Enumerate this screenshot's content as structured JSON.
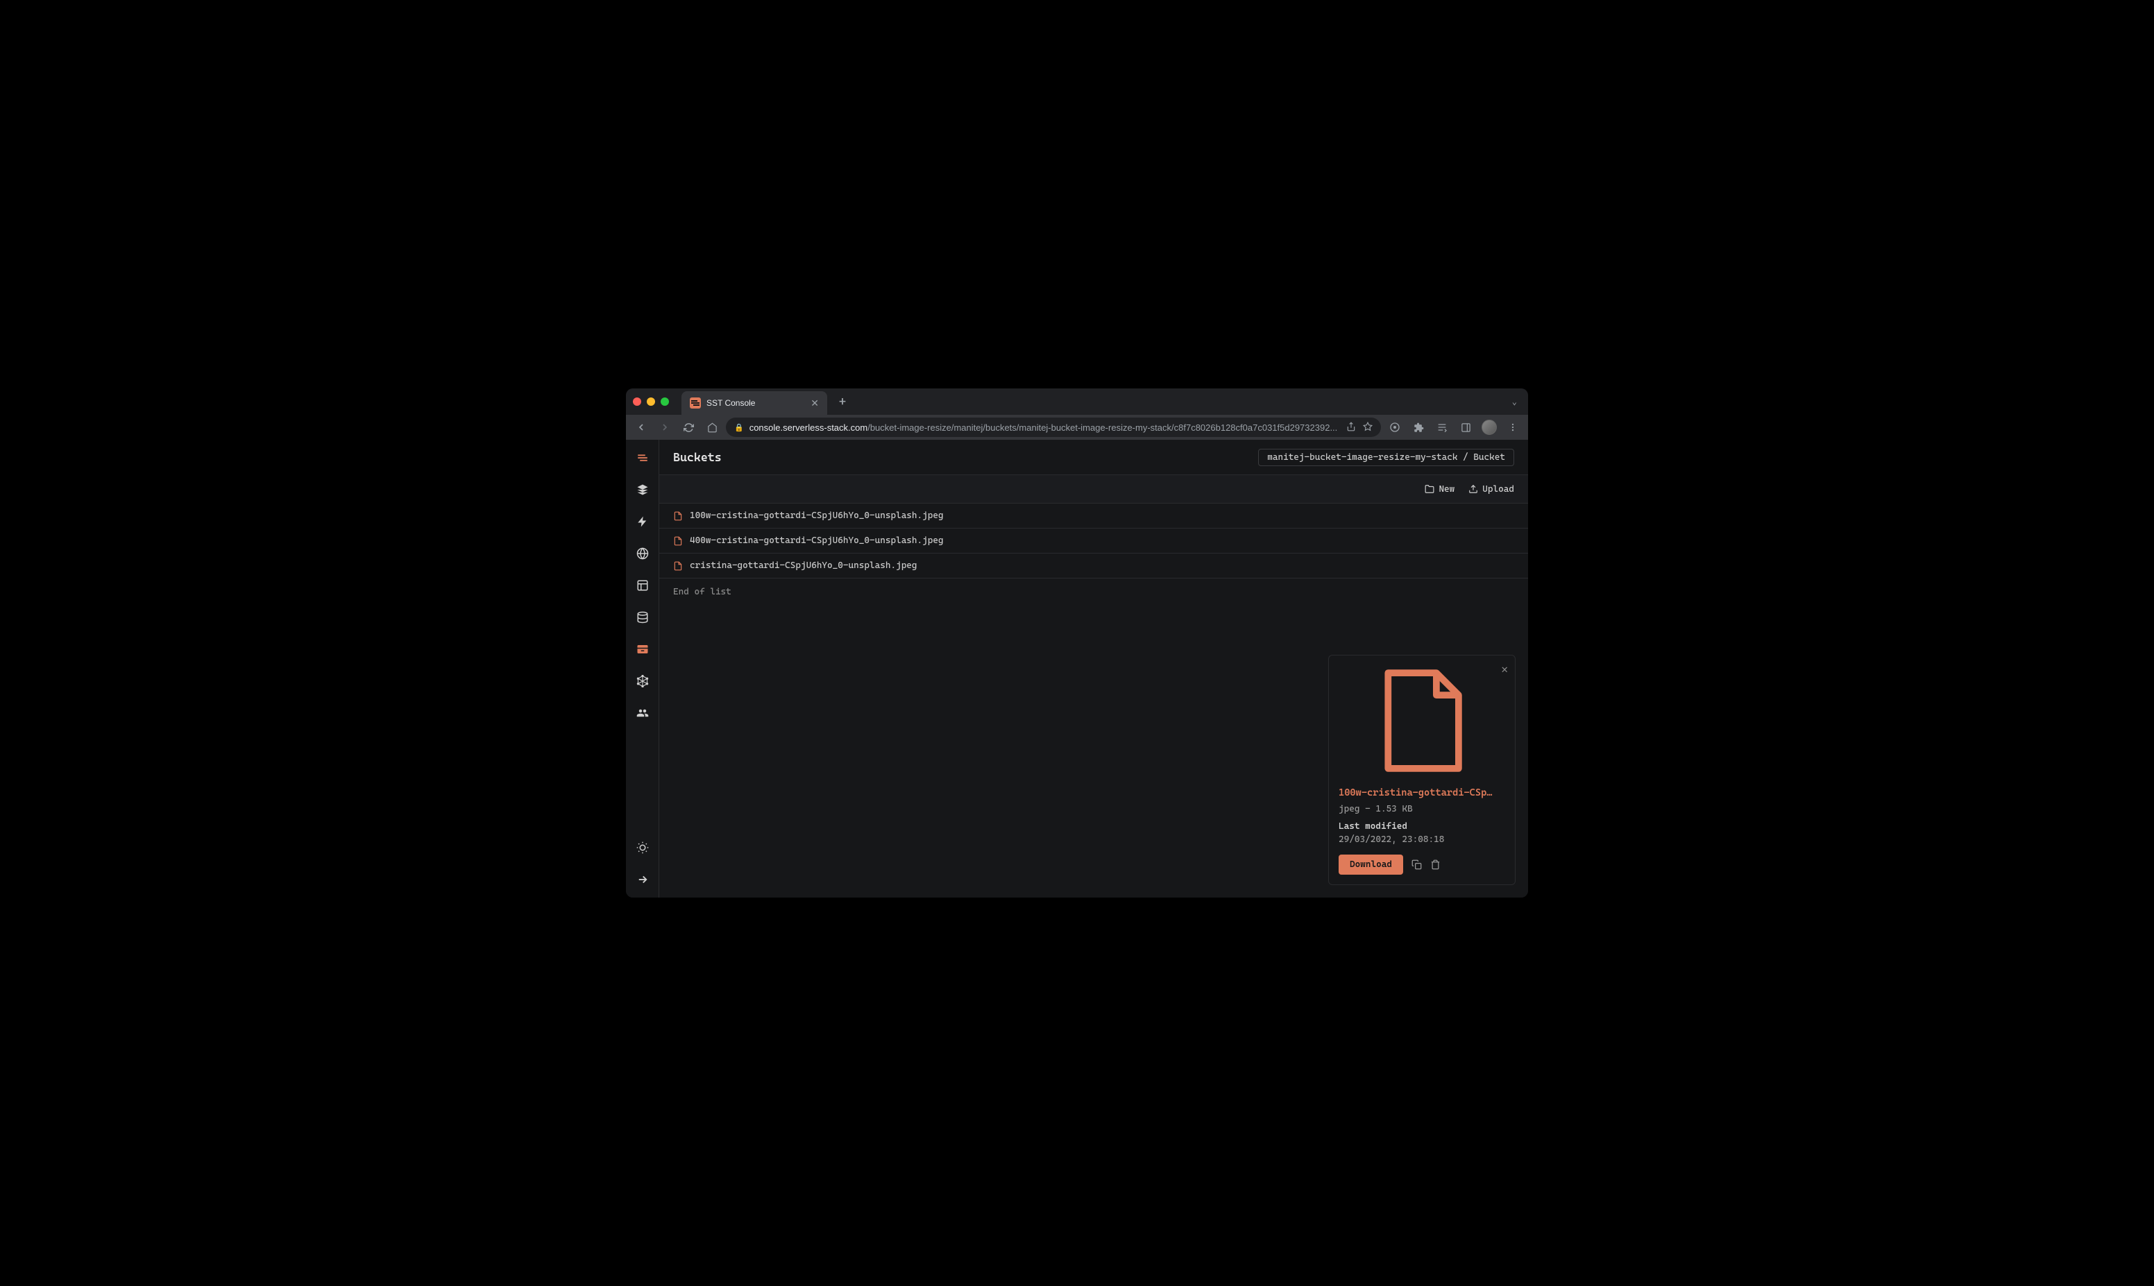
{
  "browser": {
    "tab_title": "SST Console",
    "url_domain": "console.serverless-stack.com",
    "url_path": "/bucket-image-resize/manitej/buckets/manitej-bucket-image-resize-my-stack/c8f7c8026b128cf0a7c031f5d29732392..."
  },
  "header": {
    "title": "Buckets",
    "breadcrumb": "manitej-bucket-image-resize-my-stack / Bucket"
  },
  "actions": {
    "new_label": "New",
    "upload_label": "Upload"
  },
  "files": [
    {
      "name": "100w-cristina-gottardi-CSpjU6hYo_0-unsplash.jpeg"
    },
    {
      "name": "400w-cristina-gottardi-CSpjU6hYo_0-unsplash.jpeg"
    },
    {
      "name": "cristina-gottardi-CSpjU6hYo_0-unsplash.jpeg"
    }
  ],
  "end_of_list": "End of list",
  "detail": {
    "filename": "100w-cristina-gottardi-CSp…",
    "meta": "jpeg - 1.53 KB",
    "last_modified_label": "Last modified",
    "last_modified_value": "29/03/2022, 23:08:18",
    "download_label": "Download"
  },
  "colors": {
    "accent": "#e07b5a",
    "bg": "#161719",
    "border": "#2a2b2e"
  }
}
